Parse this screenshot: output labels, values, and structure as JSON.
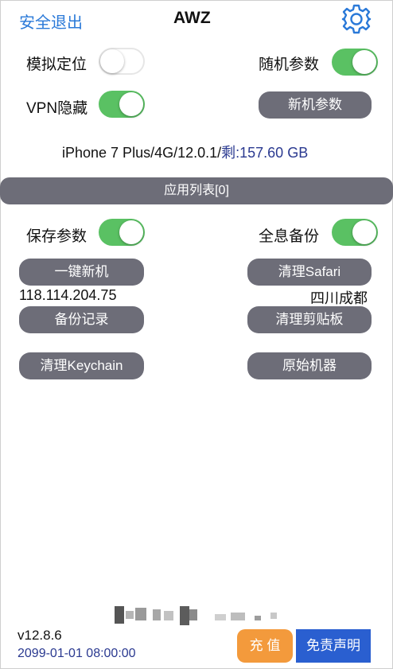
{
  "header": {
    "logout_label": "安全退出",
    "title": "AWZ",
    "settings_icon": "gear-icon"
  },
  "toggles": {
    "simulate_location": {
      "label": "模拟定位",
      "on": false
    },
    "random_params": {
      "label": "随机参数",
      "on": true
    },
    "vpn_hide": {
      "label": "VPN隐藏",
      "on": true
    },
    "save_params": {
      "label": "保存参数",
      "on": true
    },
    "full_backup": {
      "label": "全息备份",
      "on": true
    }
  },
  "buttons": {
    "new_params": "新机参数",
    "one_key_new": "一键新机",
    "clear_safari": "清理Safari",
    "backup_records": "备份记录",
    "clear_clipboard": "清理剪贴板",
    "clear_keychain": "清理Keychain",
    "original_machine": "原始机器"
  },
  "device": {
    "info_prefix": "iPhone 7 Plus/4G/12.0.1/",
    "remaining_label": "剩",
    "remaining_value": ":157.60 GB"
  },
  "app_list_label": "应用列表[0]",
  "network": {
    "ip": "118.114.204.75",
    "location": "四川成都"
  },
  "footer": {
    "version": "v12.8.6",
    "expiry": "2099-01-01 08:00:00",
    "recharge_label": "充 值",
    "disclaimer_label": "免责声明"
  },
  "colors": {
    "toggle_on": "#5ac163",
    "button_gray": "#6d6d78",
    "link_blue": "#2a79d8",
    "recharge_orange": "#f39a3c",
    "disclaimer_blue": "#2a5fd0"
  }
}
